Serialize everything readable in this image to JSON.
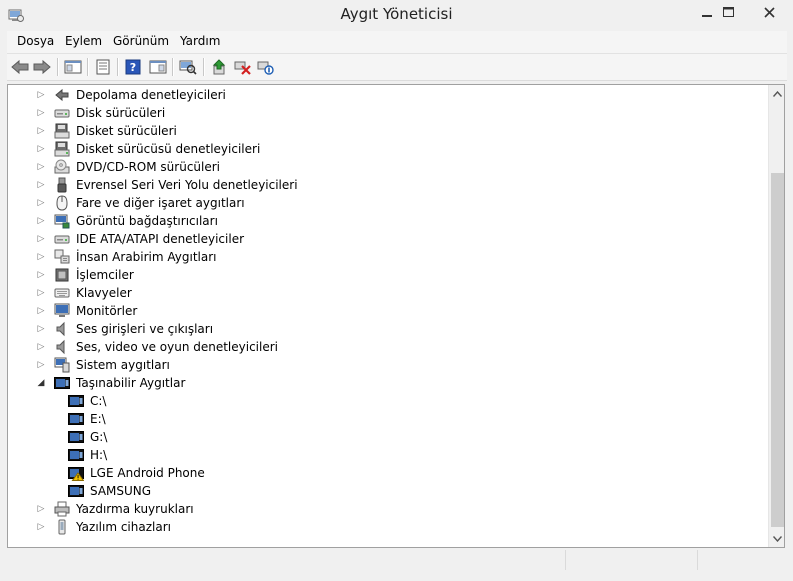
{
  "window": {
    "title": "Aygıt Yöneticisi"
  },
  "menu": [
    "Dosya",
    "Eylem",
    "Görünüm",
    "Yardım"
  ],
  "tree": {
    "categories": [
      {
        "label": "Depolama denetleyicileri",
        "icon": "storage-controller-icon",
        "expanded": false
      },
      {
        "label": "Disk sürücüleri",
        "icon": "disk-drive-icon",
        "expanded": false
      },
      {
        "label": "Disket sürücüleri",
        "icon": "floppy-drive-icon",
        "expanded": false
      },
      {
        "label": "Disket sürücüsü denetleyicileri",
        "icon": "floppy-controller-icon",
        "expanded": false
      },
      {
        "label": "DVD/CD-ROM sürücüleri",
        "icon": "dvd-drive-icon",
        "expanded": false
      },
      {
        "label": "Evrensel Seri Veri Yolu denetleyicileri",
        "icon": "usb-icon",
        "expanded": false
      },
      {
        "label": "Fare ve diğer işaret aygıtları",
        "icon": "mouse-icon",
        "expanded": false
      },
      {
        "label": "Görüntü bağdaştırıcıları",
        "icon": "display-adapter-icon",
        "expanded": false
      },
      {
        "label": "IDE ATA/ATAPI denetleyiciler",
        "icon": "ide-controller-icon",
        "expanded": false
      },
      {
        "label": "İnsan Arabirim Aygıtları",
        "icon": "hid-icon",
        "expanded": false
      },
      {
        "label": "İşlemciler",
        "icon": "processor-icon",
        "expanded": false
      },
      {
        "label": "Klavyeler",
        "icon": "keyboard-icon",
        "expanded": false
      },
      {
        "label": "Monitörler",
        "icon": "monitor-icon",
        "expanded": false
      },
      {
        "label": "Ses girişleri ve çıkışları",
        "icon": "speaker-icon",
        "expanded": false
      },
      {
        "label": "Ses, video ve oyun denetleyicileri",
        "icon": "speaker-icon",
        "expanded": false
      },
      {
        "label": "Sistem aygıtları",
        "icon": "system-device-icon",
        "expanded": false
      },
      {
        "label": "Taşınabilir Aygıtlar",
        "icon": "portable-device-icon",
        "expanded": true
      },
      {
        "label": "Yazdırma kuyrukları",
        "icon": "printer-icon",
        "expanded": false
      },
      {
        "label": "Yazılım cihazları",
        "icon": "software-device-icon",
        "expanded": false
      }
    ],
    "portable_devices": [
      {
        "label": "C:\\",
        "icon": "portable-device-icon",
        "warning": false
      },
      {
        "label": "E:\\",
        "icon": "portable-device-icon",
        "warning": false
      },
      {
        "label": "G:\\",
        "icon": "portable-device-icon",
        "warning": false
      },
      {
        "label": "H:\\",
        "icon": "portable-device-icon",
        "warning": false
      },
      {
        "label": "LGE Android Phone",
        "icon": "portable-device-warning-icon",
        "warning": true
      },
      {
        "label": "SAMSUNG",
        "icon": "portable-device-icon",
        "warning": false
      }
    ]
  },
  "colors": {
    "accent_blue": "#1f5fb4",
    "warning_yellow": "#f2c200",
    "uninstall_red": "#d32020",
    "update_green": "#2e9b35"
  }
}
